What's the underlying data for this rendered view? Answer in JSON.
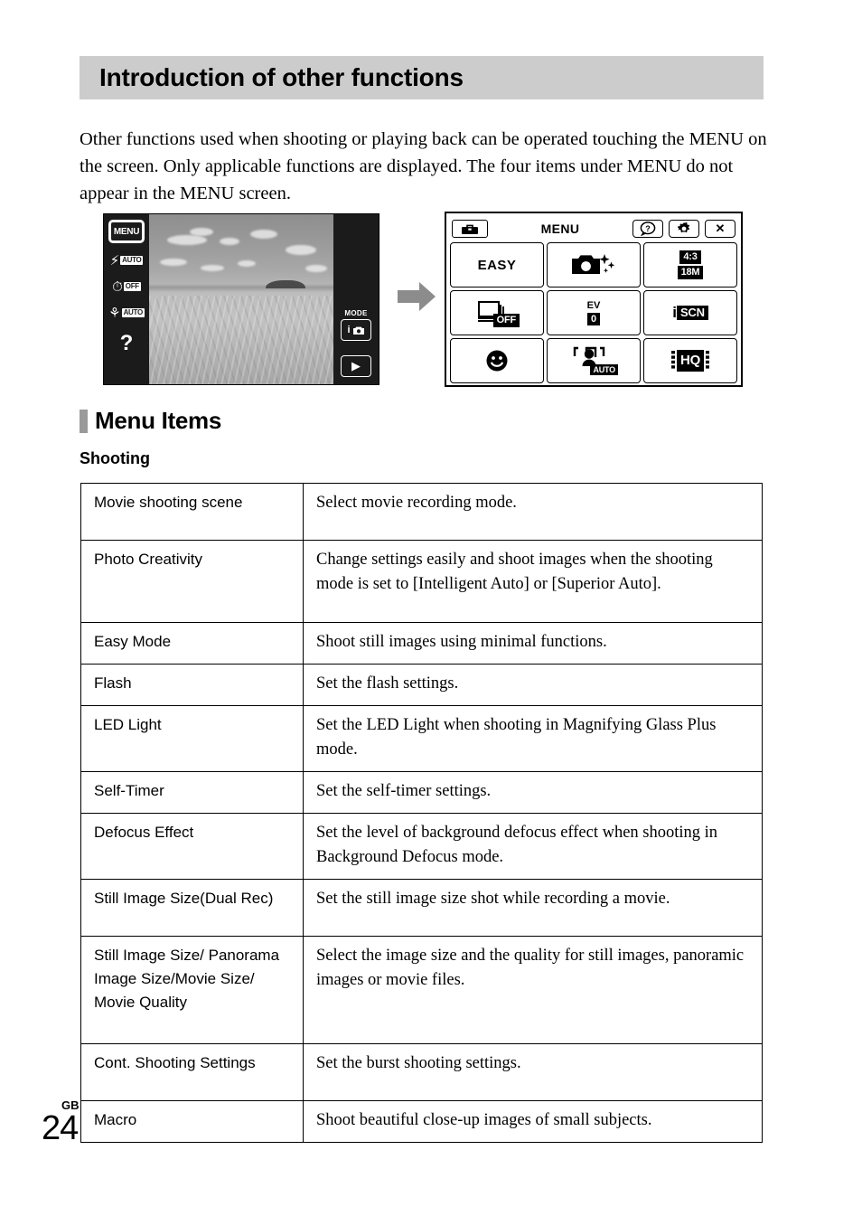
{
  "header": {
    "title": "Introduction of other functions"
  },
  "intro": {
    "paragraph": "Other functions used when shooting or playing back can be operated touching the MENU on the screen. Only applicable functions are displayed. The four items under MENU do not appear in the MENU screen."
  },
  "figure": {
    "arrow": "right-arrow",
    "camera_screen": {
      "menu_button_label": "MENU",
      "left_icons": [
        {
          "icon": "flash-icon",
          "glyph": "⚡",
          "tag": "AUTO"
        },
        {
          "icon": "self-timer-icon",
          "glyph": "⏱",
          "tag": "OFF"
        },
        {
          "icon": "macro-icon",
          "glyph": "⚘",
          "tag": "AUTO"
        }
      ],
      "help_glyph": "?",
      "mode_label": "MODE",
      "mode_button": "i",
      "playback_button": "▶"
    },
    "menu_screen": {
      "toolbox_icon": "toolbox-icon",
      "title": "MENU",
      "help_button": "?",
      "settings_button": "⚙",
      "close_button": "✕",
      "tiles": [
        {
          "name": "easy-mode-tile",
          "kind": "text",
          "label": "EASY"
        },
        {
          "name": "photo-creativity-tile",
          "kind": "camera",
          "label": ""
        },
        {
          "name": "image-size-tile",
          "kind": "two-box",
          "top": "4:3",
          "bottom": "18M"
        },
        {
          "name": "cont-shooting-tile",
          "kind": "burst-off",
          "label": "OFF"
        },
        {
          "name": "ev-tile",
          "kind": "ev",
          "label": "EV",
          "value": "0"
        },
        {
          "name": "scene-select-tile",
          "kind": "iscn",
          "prefix": "i",
          "label": "SCN"
        },
        {
          "name": "smile-shutter-tile",
          "kind": "smile",
          "label": ""
        },
        {
          "name": "face-detection-tile",
          "kind": "face-auto",
          "label": "AUTO"
        },
        {
          "name": "movie-quality-tile",
          "kind": "hq",
          "label": "HQ"
        }
      ]
    }
  },
  "sections": {
    "menu_items_heading": "Menu Items",
    "shooting_subheading": "Shooting"
  },
  "table": {
    "rows": [
      {
        "term": "Movie shooting scene",
        "desc": "Select movie recording mode."
      },
      {
        "term": "Photo Creativity",
        "desc": "Change settings easily and shoot images when the shooting mode is set to [Intelligent Auto] or [Superior Auto]."
      },
      {
        "term": "Easy Mode",
        "desc": "Shoot still images using minimal functions."
      },
      {
        "term": "Flash",
        "desc": "Set the flash settings."
      },
      {
        "term": "LED Light",
        "desc": "Set the LED Light when shooting in Magnifying Glass Plus mode."
      },
      {
        "term": "Self-Timer",
        "desc": "Set the self-timer settings."
      },
      {
        "term": "Defocus Effect",
        "desc": "Set the level of background defocus effect when shooting in Background Defocus mode."
      },
      {
        "term": "Still Image Size(Dual Rec)",
        "desc": "Set the still image size shot while recording a movie."
      },
      {
        "term": "Still Image Size/ Panorama Image Size/Movie Size/ Movie Quality",
        "desc": "Select the image size and the quality for still images, panoramic images or movie files."
      },
      {
        "term": "Cont. Shooting Settings",
        "desc": "Set the burst shooting settings."
      },
      {
        "term": "Macro",
        "desc": "Shoot beautiful close-up images of small subjects."
      }
    ]
  },
  "folio": {
    "region": "GB",
    "page_number": "24"
  },
  "colors": {
    "header_band": "#cccccc",
    "section_bar": "#9a9a9a",
    "arrow": "#8c8c8c",
    "screen_black": "#1b1b1b"
  }
}
